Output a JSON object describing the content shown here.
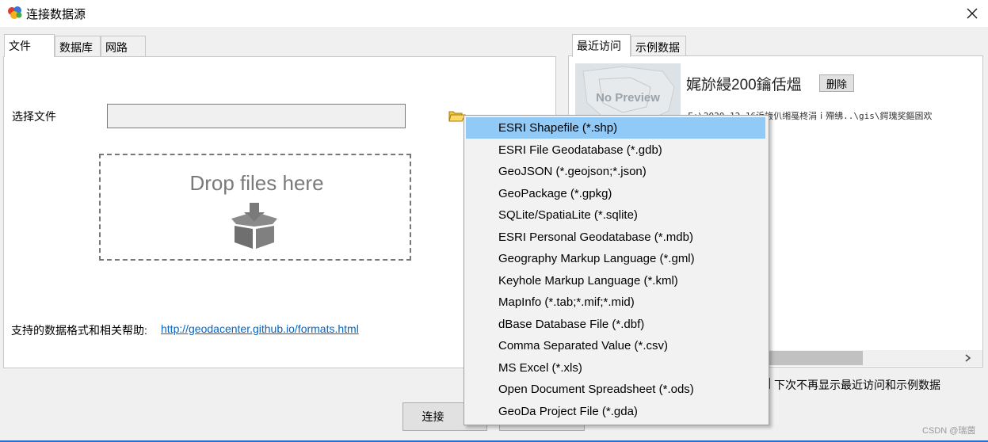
{
  "window": {
    "title": "连接数据源"
  },
  "left_tabs": [
    "文件",
    "数据库",
    "网路"
  ],
  "file": {
    "label": "选择文件",
    "drop_text": "Drop files here",
    "help_label": "支持的数据格式和相关帮助:",
    "help_link": "http://geodacenter.github.io/formats.html"
  },
  "right_tabs": [
    "最近访问",
    "示例数据"
  ],
  "recent": {
    "preview_text": "No Preview",
    "name": "娓旀綅200鑰佸熅",
    "delete_label": "删除",
    "path": "F:\\2020-12-16浜旇仈缃戞柊涓ｉ殢绋..\\gis\\鍔瑰奖鏂囦欢"
  },
  "no_show_label": "下次不再显示最近访问和示例数据",
  "buttons": {
    "connect": "连接"
  },
  "menu": {
    "highlighted": 0,
    "items": [
      "ESRI Shapefile (*.shp)",
      "ESRI File Geodatabase (*.gdb)",
      "GeoJSON (*.geojson;*.json)",
      "GeoPackage (*.gpkg)",
      "SQLite/SpatiaLite (*.sqlite)",
      "ESRI Personal Geodatabase (*.mdb)",
      "Geography Markup Language (*.gml)",
      "Keyhole Markup Language (*.kml)",
      "MapInfo (*.tab;*.mif;*.mid)",
      "dBase Database File (*.dbf)",
      "Comma Separated Value (*.csv)",
      "MS Excel (*.xls)",
      "Open Document Spreadsheet (*.ods)",
      "GeoDa Project File (*.gda)"
    ]
  },
  "watermark": "CSDN @瑞茵",
  "colors": {
    "menu_highlight": "#91c9f7",
    "link": "#0066cc",
    "accent_line": "#2a6fc9"
  },
  "icons": [
    "app-icon",
    "close-icon",
    "folder-open-icon",
    "download-box-icon",
    "chevron-right-icon"
  ]
}
